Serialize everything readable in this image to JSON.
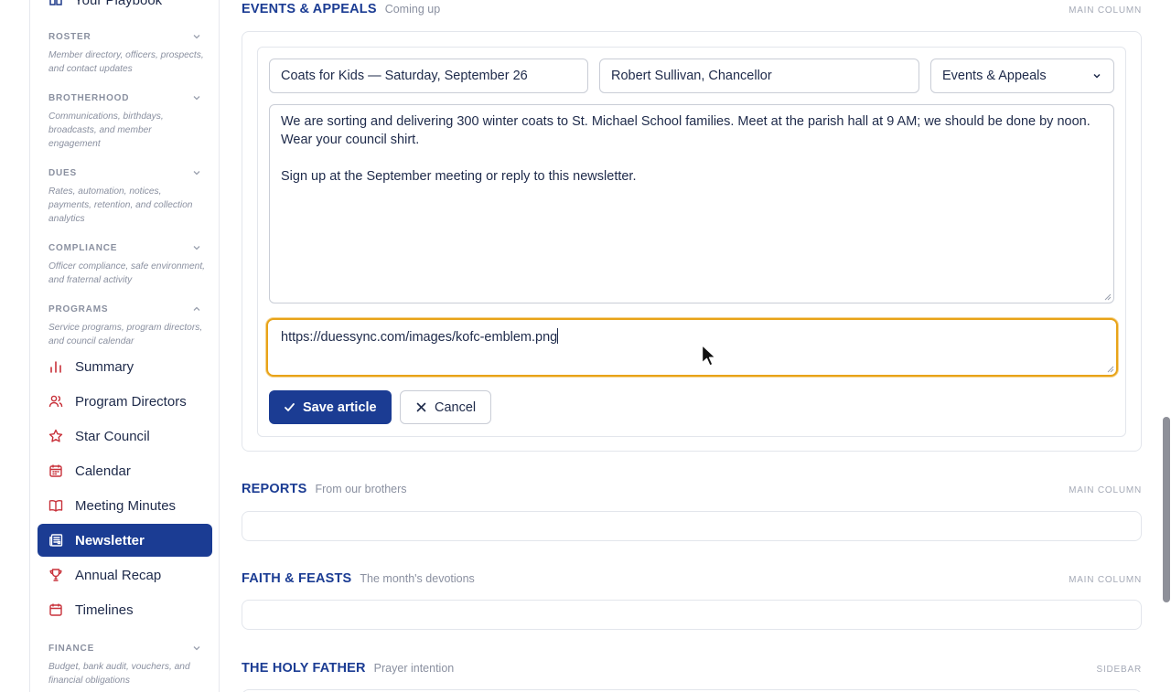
{
  "sidebar": {
    "top_item": {
      "label": "Your Playbook",
      "icon": "book-icon"
    },
    "sections": {
      "roster": {
        "title": "ROSTER",
        "description": "Member directory, officers, prospects, and contact updates"
      },
      "brotherhood": {
        "title": "BROTHERHOOD",
        "description": "Communications, birthdays, broadcasts, and member engagement"
      },
      "dues": {
        "title": "DUES",
        "description": "Rates, automation, notices, payments, retention, and collection analytics"
      },
      "compliance": {
        "title": "COMPLIANCE",
        "description": "Officer compliance, safe environment, and fraternal activity"
      },
      "programs": {
        "title": "PROGRAMS",
        "description": "Service programs, program directors, and council calendar"
      },
      "finance": {
        "title": "FINANCE",
        "description": "Budget, bank audit, vouchers, and financial obligations"
      }
    },
    "program_items": [
      {
        "label": "Summary",
        "icon": "bar-chart-icon"
      },
      {
        "label": "Program Directors",
        "icon": "users-icon"
      },
      {
        "label": "Star Council",
        "icon": "star-icon"
      },
      {
        "label": "Calendar",
        "icon": "calendar-icon"
      },
      {
        "label": "Meeting Minutes",
        "icon": "open-book-icon"
      },
      {
        "label": "Newsletter",
        "icon": "newspaper-icon",
        "active": true
      },
      {
        "label": "Annual Recap",
        "icon": "trophy-icon"
      },
      {
        "label": "Timelines",
        "icon": "calendar-icon"
      }
    ]
  },
  "main": {
    "events": {
      "title": "EVENTS & APPEALS",
      "subtitle": "Coming up",
      "tag": "MAIN COLUMN",
      "form": {
        "headline_value": "Coats for Kids — Saturday, September 26",
        "author_value": "Robert Sullivan, Chancellor",
        "section_selected": "Events & Appeals",
        "body_paragraph_1": "We are sorting and delivering 300 winter coats to St. Michael School families. Meet at the parish hall at 9 AM; we should be done by noon. Wear your council shirt.",
        "body_paragraph_2": "Sign up at the September meeting or reply to this newsletter.",
        "image_url_value": "https://duessync.com/images/kofc-emblem.png",
        "save_label": "Save article",
        "cancel_label": "Cancel"
      }
    },
    "reports": {
      "title": "REPORTS",
      "subtitle": "From our brothers",
      "tag": "MAIN COLUMN"
    },
    "faith": {
      "title": "FAITH & FEASTS",
      "subtitle": "The month's devotions",
      "tag": "MAIN COLUMN"
    },
    "holy_father": {
      "title": "THE HOLY FATHER",
      "subtitle": "Prayer intention",
      "tag": "SIDEBAR"
    }
  },
  "colors": {
    "brand_navy": "#1b3c93",
    "accent_red": "#c8313a",
    "focus_amber": "#e8a318"
  }
}
